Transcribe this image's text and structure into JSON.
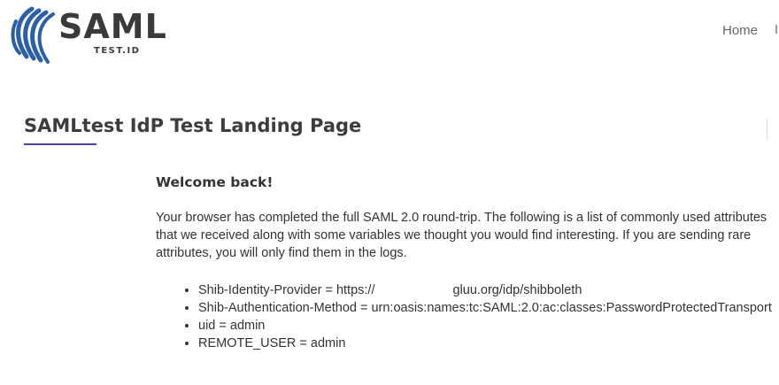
{
  "header": {
    "logo_word": "SAML",
    "logo_sub": "TEST.ID",
    "nav": {
      "home": "Home"
    }
  },
  "page": {
    "title": "SAMLtest IdP Test Landing Page"
  },
  "content": {
    "welcome": "Welcome back!",
    "intro": "Your browser has completed the full SAML 2.0 round-trip. The following is a list of commonly used attributes that we received along with some variables we thought you would find interesting. If you are sending rare attributes, you will only find them in the logs.",
    "attributes": [
      {
        "prefix": "Shib-Identity-Provider = https://",
        "suffix": "gluu.org/idp/shibboleth"
      },
      {
        "prefix": "Shib-Authentication-Method = urn:oasis:names:tc:SAML:2.0:ac:classes:PasswordProtectedTransport",
        "suffix": ""
      },
      {
        "prefix": "uid = admin",
        "suffix": ""
      },
      {
        "prefix": "REMOTE_USER = admin",
        "suffix": ""
      }
    ]
  },
  "colors": {
    "logo_blue": "#2b5fa8",
    "accent_underline": "#4a3fb5",
    "text": "#333333"
  },
  "icons": {
    "logo_mark": "saml-swoosh-logo-icon"
  }
}
